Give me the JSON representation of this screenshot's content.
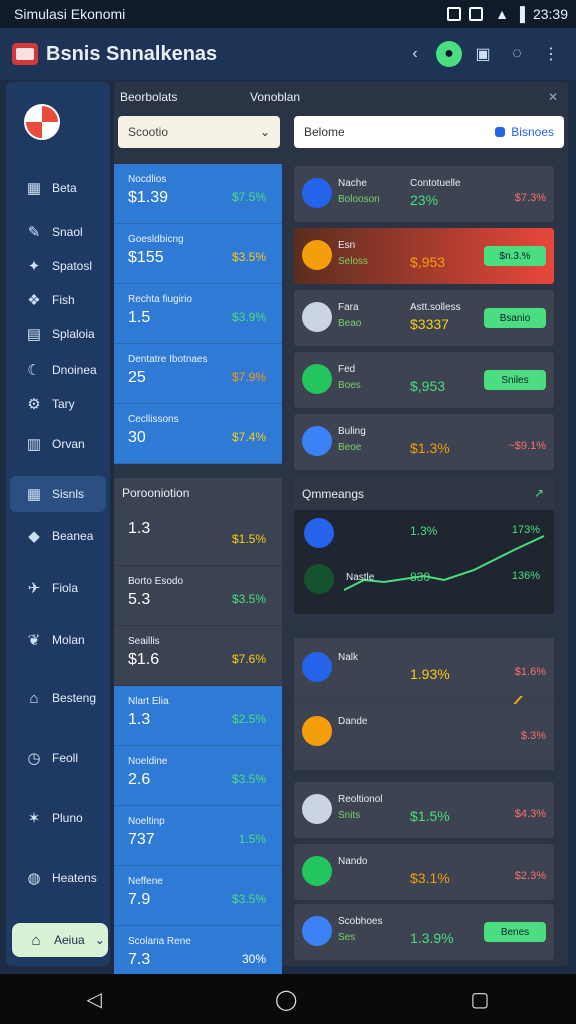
{
  "status": {
    "title": "Simulasi Ekonomi",
    "time": "23:39"
  },
  "app": {
    "title": "Bsnis Snnalkenas"
  },
  "sidebar": {
    "items": [
      {
        "label": "Beta",
        "icon": "chart-icon"
      },
      {
        "label": "Snaol",
        "icon": "pen-icon"
      },
      {
        "label": "Spatosl",
        "icon": "pin-icon"
      },
      {
        "label": "Fish",
        "icon": "fish-icon"
      },
      {
        "label": "Splaloia",
        "icon": "book-icon"
      },
      {
        "label": "Dnoinea",
        "icon": "moon-icon"
      },
      {
        "label": "Tary",
        "icon": "gear-icon"
      },
      {
        "label": "Orvan",
        "icon": "building-icon"
      },
      {
        "label": "Sisnls",
        "icon": "grid-icon"
      },
      {
        "label": "Beanea",
        "icon": "drop-icon"
      },
      {
        "label": "Fiola",
        "icon": "plane-icon"
      },
      {
        "label": "Molan",
        "icon": "leaf-icon"
      },
      {
        "label": "Besteng",
        "icon": "bank-icon"
      },
      {
        "label": "Feoll",
        "icon": "clock-icon"
      },
      {
        "label": "Pluno",
        "icon": "star-icon"
      },
      {
        "label": "Heatens",
        "icon": "fire-icon"
      }
    ],
    "footer": {
      "label": "Aeiua",
      "icon": "home-icon"
    }
  },
  "panel": {
    "tab1": "Beorbolats",
    "tab2": "Vonoblan",
    "select_value": "Scootio",
    "search_value": "Belome",
    "search_button": "Bisnoes",
    "left_cards": [
      {
        "label": "Nocdlios",
        "value": "$1.39",
        "pct": "$7.5%",
        "tone": "blue",
        "color": "g"
      },
      {
        "label": "Goesldbicng",
        "value": "$155",
        "pct": "$3.5%",
        "tone": "blue",
        "color": "y"
      },
      {
        "label": "Rechta fiugirio",
        "value": "1.5",
        "pct": "$3.9%",
        "tone": "blue",
        "color": "g"
      },
      {
        "label": "Dentatre Ibotnaes",
        "value": "25",
        "pct": "$7.9%",
        "tone": "blue",
        "color": "o"
      },
      {
        "label": "Cecllissons",
        "value": "30",
        "pct": "$7.4%",
        "tone": "blue",
        "color": "y"
      }
    ],
    "left_head": "Porooniotion",
    "left_cards2": [
      {
        "label": "",
        "value": "1.3",
        "pct": "$1.5%",
        "tone": "gray",
        "color": "y"
      },
      {
        "label": "Borto Esodo",
        "value": "5.3",
        "pct": "$3.5%",
        "tone": "gray",
        "color": "g"
      },
      {
        "label": "Seaillis",
        "value": "$1.6",
        "pct": "$7.6%",
        "tone": "gray",
        "color": "y"
      },
      {
        "label": "Nlart Elia",
        "value": "1.3",
        "pct": "$2.5%",
        "tone": "blue",
        "color": "g"
      },
      {
        "label": "Noeldine",
        "value": "2.6",
        "pct": "$3.5%",
        "tone": "blue",
        "color": "g"
      },
      {
        "label": "Noeltinp",
        "value": "737",
        "pct": "1.5%",
        "tone": "blue",
        "color": "g"
      },
      {
        "label": "Neffene",
        "value": "7.9",
        "pct": "$3.5%",
        "tone": "blue",
        "color": "g"
      },
      {
        "label": "Scolana Rene",
        "value": "7.3",
        "pct": "30%",
        "tone": "blue",
        "color": "w"
      }
    ],
    "right_cards": [
      {
        "name": "Nache",
        "sub": "Bolooson",
        "head": "Contotuelle",
        "value": "23%",
        "right": "$7.3%",
        "vcolor": "g",
        "rcolor": "g"
      },
      {
        "name": "Esn",
        "sub": "Seloss",
        "head": "",
        "value": "$,953",
        "right": "$n.3.%",
        "vcolor": "o",
        "rcolor": "b"
      },
      {
        "name": "Fara",
        "sub": "Beao",
        "head": "Astt.solless",
        "value": "$3337",
        "right": "Bsanio",
        "vcolor": "y",
        "rcolor": "g"
      },
      {
        "name": "Fed",
        "sub": "Boes",
        "head": "",
        "value": "$,953",
        "right": "Sniles",
        "vcolor": "g",
        "rcolor": "g"
      },
      {
        "name": "Buling",
        "sub": "Beoe",
        "head": "",
        "value": "$1.3%",
        "right": "~$9.1%",
        "vcolor": "o",
        "rcolor": "o"
      }
    ],
    "right_head": "Qmmeangs",
    "chart_cards": [
      {
        "name": "",
        "value": "1.3%",
        "right": "173%"
      },
      {
        "name": "Nastle",
        "value": "830",
        "right": "136%"
      }
    ],
    "right_cards2": [
      {
        "name": "Nalk",
        "sub": "",
        "head": "",
        "value": "1.93%",
        "right": "$1.6%",
        "vcolor": "y",
        "rcolor": "o"
      },
      {
        "name": "Dande",
        "sub": "",
        "head": "",
        "value": "",
        "right": "$.3%",
        "vcolor": "g",
        "rcolor": "g"
      },
      {
        "name": "Reoltionol",
        "sub": "Snits",
        "head": "",
        "value": "$1.5%",
        "right": "$4.3%",
        "vcolor": "g",
        "rcolor": "g"
      },
      {
        "name": "Nando",
        "sub": "",
        "head": "",
        "value": "$3.1%",
        "right": "$2.3%",
        "vcolor": "o",
        "rcolor": "g"
      },
      {
        "name": "Scobhoes",
        "sub": "Ses",
        "head": "",
        "value": "1.3.9%",
        "right": "Benes",
        "vcolor": "g",
        "rcolor": "g"
      }
    ]
  }
}
